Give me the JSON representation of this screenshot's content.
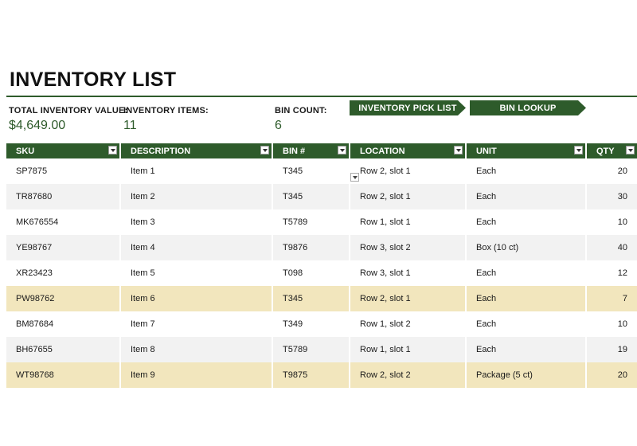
{
  "page": {
    "title": "INVENTORY LIST"
  },
  "summary": {
    "total_value_label": "TOTAL INVENTORY VALUE:",
    "total_value": "$4,649.00",
    "items_label": "INVENTORY ITEMS:",
    "items": "11",
    "bin_label": "BIN COUNT:",
    "bin": "6"
  },
  "nav": {
    "pick_list": "INVENTORY PICK LIST",
    "bin_lookup": "BIN LOOKUP"
  },
  "colors": {
    "header_green": "#2e5b2b",
    "highlight_row": "#f2e6bd",
    "alt_row": "#f2f2f2"
  },
  "table": {
    "columns": [
      "SKU",
      "DESCRIPTION",
      "BIN #",
      "LOCATION",
      "UNIT",
      "QTY"
    ],
    "rows": [
      {
        "sku": "SP7875",
        "desc": "Item 1",
        "bin": "T345",
        "loc": "Row 2, slot 1",
        "unit": "Each",
        "qty": "20",
        "style": "plain"
      },
      {
        "sku": "TR87680",
        "desc": "Item 2",
        "bin": "T345",
        "loc": "Row 2, slot 1",
        "unit": "Each",
        "qty": "30",
        "style": "alt"
      },
      {
        "sku": "MK676554",
        "desc": "Item 3",
        "bin": "T5789",
        "loc": "Row 1, slot 1",
        "unit": "Each",
        "qty": "10",
        "style": "plain"
      },
      {
        "sku": "YE98767",
        "desc": "Item 4",
        "bin": "T9876",
        "loc": "Row 3, slot 2",
        "unit": "Box (10 ct)",
        "qty": "40",
        "style": "alt"
      },
      {
        "sku": "XR23423",
        "desc": "Item 5",
        "bin": "T098",
        "loc": "Row 3, slot 1",
        "unit": "Each",
        "qty": "12",
        "style": "plain"
      },
      {
        "sku": "PW98762",
        "desc": "Item 6",
        "bin": "T345",
        "loc": "Row 2, slot 1",
        "unit": "Each",
        "qty": "7",
        "style": "hl"
      },
      {
        "sku": "BM87684",
        "desc": "Item 7",
        "bin": "T349",
        "loc": "Row 1, slot 2",
        "unit": "Each",
        "qty": "10",
        "style": "plain"
      },
      {
        "sku": "BH67655",
        "desc": "Item 8",
        "bin": "T5789",
        "loc": "Row 1, slot 1",
        "unit": "Each",
        "qty": "19",
        "style": "alt"
      },
      {
        "sku": "WT98768",
        "desc": "Item 9",
        "bin": "T9875",
        "loc": "Row 2, slot 2",
        "unit": "Package (5 ct)",
        "qty": "20",
        "style": "hl"
      }
    ]
  }
}
